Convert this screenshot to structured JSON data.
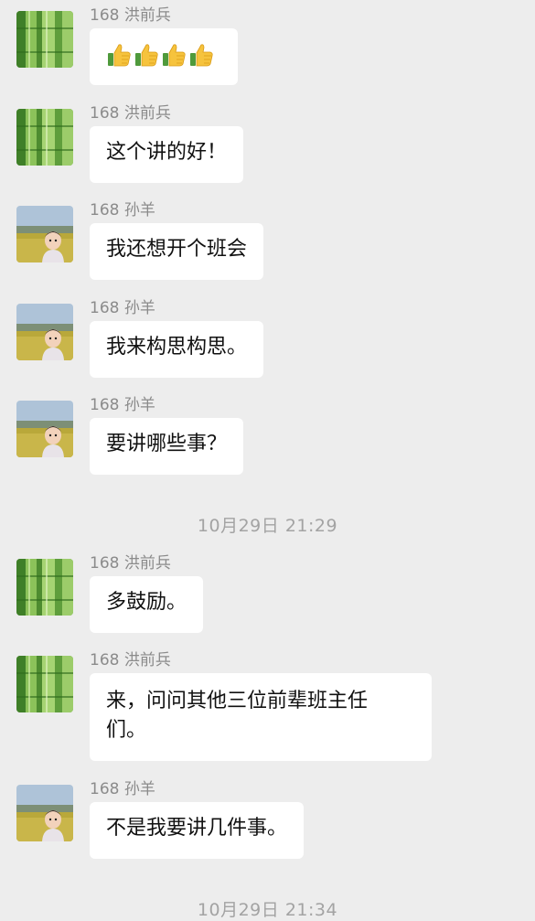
{
  "messages": [
    {
      "sender": "168 洪前兵",
      "avatar": "bamboo-avatar",
      "text": "",
      "emoji": [
        "thumbs-up",
        "thumbs-up",
        "thumbs-up",
        "thumbs-up"
      ]
    },
    {
      "sender": "168 洪前兵",
      "avatar": "bamboo-avatar",
      "text": "这个讲的好！"
    },
    {
      "sender": "168 孙羊",
      "avatar": "child-avatar",
      "text": "我还想开个班会"
    },
    {
      "sender": "168 孙羊",
      "avatar": "child-avatar",
      "text": "我来构思构思。"
    },
    {
      "sender": "168 孙羊",
      "avatar": "child-avatar",
      "text": "要讲哪些事？"
    },
    {
      "sender": "168 洪前兵",
      "avatar": "bamboo-avatar",
      "text": "多鼓励。"
    },
    {
      "sender": "168 洪前兵",
      "avatar": "bamboo-avatar",
      "text_line1": "来，问问其他三位前辈班主任",
      "text_line2": "们。"
    },
    {
      "sender": "168 孙羊",
      "avatar": "child-avatar",
      "text": "不是我要讲几件事。"
    }
  ],
  "timestamps": [
    "10月29日 21:29",
    "10月29日 21:34"
  ]
}
